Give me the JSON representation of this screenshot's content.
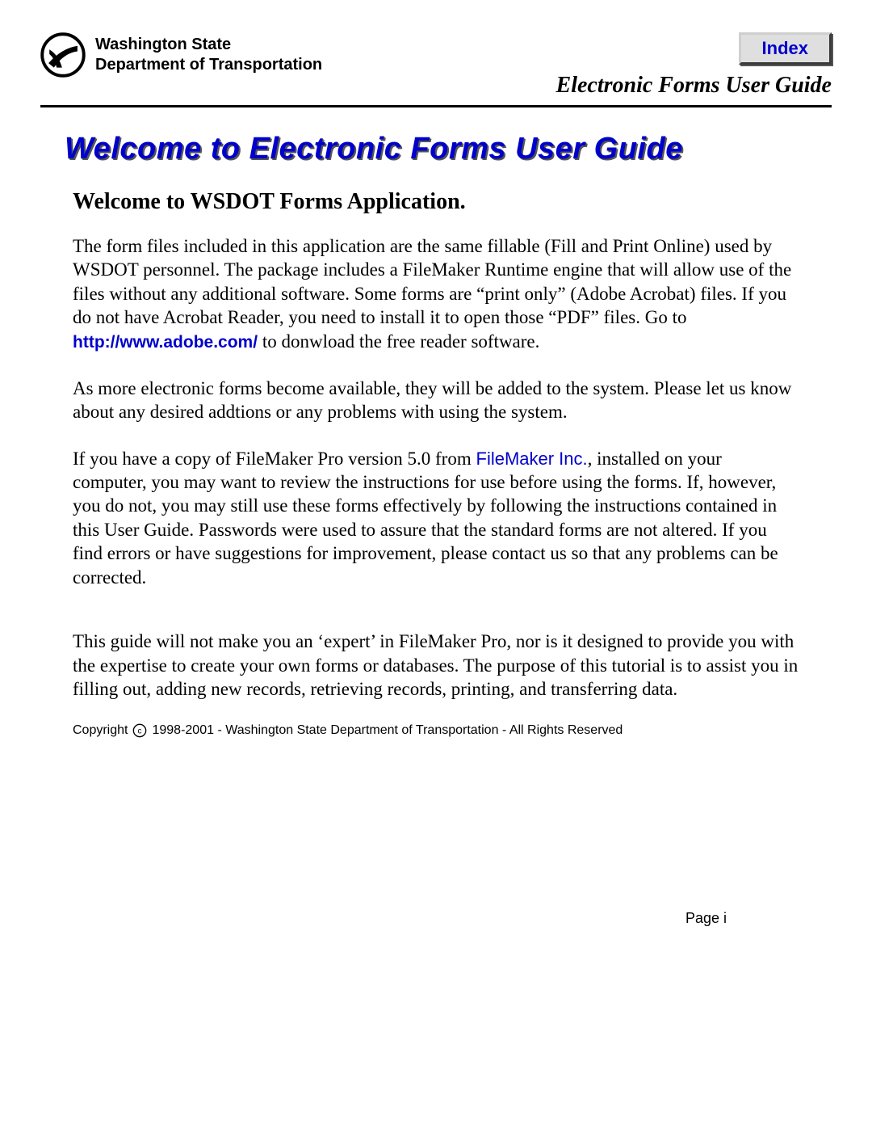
{
  "header": {
    "org_line1": "Washington State",
    "org_line2": "Department of Transportation",
    "index_label": "Index",
    "subtitle": "Electronic Forms User Guide"
  },
  "title": "Welcome to Electronic Forms User Guide",
  "section_heading": "Welcome to WSDOT Forms Application.",
  "paragraphs": {
    "p1a": "The form files included in this application are the same fillable (Fill and Print Online) used by WSDOT personnel.  The package includes a FileMaker Runtime engine that will allow use of the files without any additional software.  Some forms are “print only” (Adobe Acrobat) files.  If you do not have Acrobat Reader, you need to install it to open those “PDF” files.  Go to ",
    "p1link": "http://www.adobe.com/",
    "p1b": "  to donwload the free reader software.",
    "p2": "As more electronic forms become available, they will be added to the system.  Please let us know about any desired addtions or any problems with using the system.",
    "p3a": "If you have a copy of FileMaker Pro version 5.0 from ",
    "p3link": "FileMaker Inc.",
    "p3b": ", installed on your computer, you may want to review the instructions for use before using the forms.  If, however, you do not, you may still use these forms effectively by following the instructions contained in this User Guide.  Passwords were used to assure that the standard forms are not altered.  If you find errors or have suggestions for improvement, please contact us so that any problems can be corrected.",
    "p4": "This guide will not make you an ‘expert’ in FileMaker Pro, nor is it designed to provide you with the expertise to create your own forms or databases. The purpose of this tutorial is to assist you in filling out, adding new records, retrieving records, printing, and transferring data."
  },
  "copyright": {
    "prefix": "Copyright",
    "symbol": "c",
    "text": "1998-2001 - Washington State Department of Transportation - All Rights Reserved"
  },
  "footer": {
    "page_label": "Page  i"
  }
}
